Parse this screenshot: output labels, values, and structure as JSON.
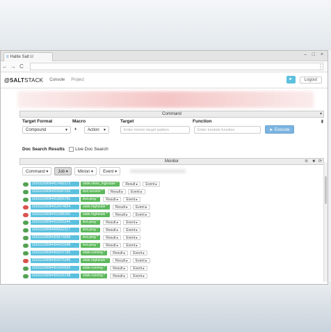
{
  "browser": {
    "tab_title": "Halite Salt U",
    "back": "←",
    "forward": "→",
    "reload": "C",
    "menu": "⋮",
    "minimize": "–",
    "maximize": "□",
    "close": "×"
  },
  "app": {
    "logo_prefix": "@",
    "logo_text": "SALT",
    "logo_suffix": "STACK",
    "nav": [
      "Console",
      "Project"
    ],
    "user_icon": "►",
    "logout": "Logout"
  },
  "command_panel": {
    "title": "Command",
    "target_format_label": "Target Format",
    "target_format_value": "Compound",
    "macro_label": "Macro",
    "macro_icon": "♦",
    "macro_value": "Action",
    "target_label": "Target",
    "target_placeholder": "Enter minion target pattern",
    "function_label": "Function",
    "function_placeholder": "Enter module function",
    "execute_label": "► Execute"
  },
  "docs": {
    "label": "Doc Search Results",
    "live_label": "Live Doc Search"
  },
  "monitor": {
    "title": "Monitor",
    "filters": [
      {
        "label": "Command ▾",
        "active": false
      },
      {
        "label": "Job ▾",
        "active": true
      },
      {
        "label": "Minion ▾",
        "active": false
      },
      {
        "label": "Event ▾",
        "active": false
      }
    ],
    "jobs": [
      {
        "jid": "20161109094417492172",
        "fun": "state.show_highstate *",
        "status": "ok"
      },
      {
        "jid": "20161109094415587250",
        "fun": "test.version *",
        "status": "ok"
      },
      {
        "jid": "20161109094413666781",
        "fun": "test.ping *",
        "status": "ok"
      },
      {
        "jid": "20161109094412474654",
        "fun": "state.highstate *",
        "status": "err"
      },
      {
        "jid": "20161109094411686150",
        "fun": "state.highstate *",
        "status": "err"
      },
      {
        "jid": "20161109094410255244",
        "fun": "test.ping *",
        "status": "ok"
      },
      {
        "jid": "20161109094406662117",
        "fun": "test.ping *",
        "status": "ok"
      },
      {
        "jid": "20161109094405576689",
        "fun": "test.ping *",
        "status": "ok"
      },
      {
        "jid": "20161109094404433348",
        "fun": "test.ping *",
        "status": "ok"
      },
      {
        "jid": "20161109094403247185",
        "fun": "state.running *",
        "status": "ok"
      },
      {
        "jid": "20161109094402475346",
        "fun": "state.highstate *",
        "status": "err"
      },
      {
        "jid": "20161109094401426555",
        "fun": "state.running *",
        "status": "ok"
      },
      {
        "jid": "20161109094400226798",
        "fun": "state.running *",
        "status": "ok"
      }
    ],
    "result_label": "Result ▸",
    "event_label": "Event ▸"
  }
}
